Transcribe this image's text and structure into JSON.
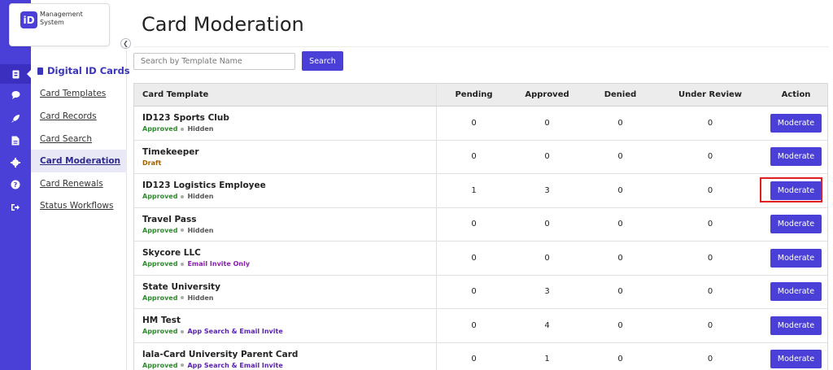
{
  "logo": {
    "badge": "iD",
    "text": "Management\nSystem"
  },
  "sidebar": {
    "title": "Digital ID Cards",
    "items": [
      {
        "label": "Card Templates",
        "active": false
      },
      {
        "label": "Card Records",
        "active": false
      },
      {
        "label": "Card Search",
        "active": false
      },
      {
        "label": "Card Moderation",
        "active": true
      },
      {
        "label": "Card Renewals",
        "active": false
      },
      {
        "label": "Status Workflows",
        "active": false
      }
    ]
  },
  "rail": {
    "icons": [
      "id-card-icon",
      "chat-icon",
      "rocket-icon",
      "document-icon",
      "gear-icon",
      "help-icon",
      "logout-icon"
    ]
  },
  "page": {
    "title": "Card Moderation"
  },
  "search": {
    "placeholder": "Search by Template Name",
    "button_label": "Search"
  },
  "table": {
    "headers": [
      "Card Template",
      "Pending",
      "Approved",
      "Denied",
      "Under Review",
      "Action"
    ],
    "rows": [
      {
        "name": "ID123 Sports Club",
        "status": "Approved",
        "visibility": "Hidden",
        "pending": "0",
        "approved": "0",
        "denied": "0",
        "review": "0",
        "action": "Moderate"
      },
      {
        "name": "Timekeeper",
        "status": "Draft",
        "visibility": "",
        "pending": "0",
        "approved": "0",
        "denied": "0",
        "review": "0",
        "action": "Moderate"
      },
      {
        "name": "ID123 Logistics Employee",
        "status": "Approved",
        "visibility": "Hidden",
        "pending": "1",
        "approved": "3",
        "denied": "0",
        "review": "0",
        "action": "Moderate"
      },
      {
        "name": "Travel Pass",
        "status": "Approved",
        "visibility": "Hidden",
        "pending": "0",
        "approved": "0",
        "denied": "0",
        "review": "0",
        "action": "Moderate"
      },
      {
        "name": "Skycore LLC",
        "status": "Approved",
        "visibility": "Email Invite Only",
        "pending": "0",
        "approved": "0",
        "denied": "0",
        "review": "0",
        "action": "Moderate"
      },
      {
        "name": "State University",
        "status": "Approved",
        "visibility": "Hidden",
        "pending": "0",
        "approved": "3",
        "denied": "0",
        "review": "0",
        "action": "Moderate"
      },
      {
        "name": "HM Test",
        "status": "Approved",
        "visibility": "App Search & Email Invite",
        "pending": "0",
        "approved": "4",
        "denied": "0",
        "review": "0",
        "action": "Moderate"
      },
      {
        "name": "lala-Card University Parent Card",
        "status": "Approved",
        "visibility": "App Search & Email Invite",
        "pending": "0",
        "approved": "1",
        "denied": "0",
        "review": "0",
        "action": "Moderate"
      }
    ]
  },
  "colors": {
    "brand": "#4a3fd6",
    "approved": "#2e8b2e",
    "draft": "#a06000",
    "highlight": "#e02020"
  }
}
